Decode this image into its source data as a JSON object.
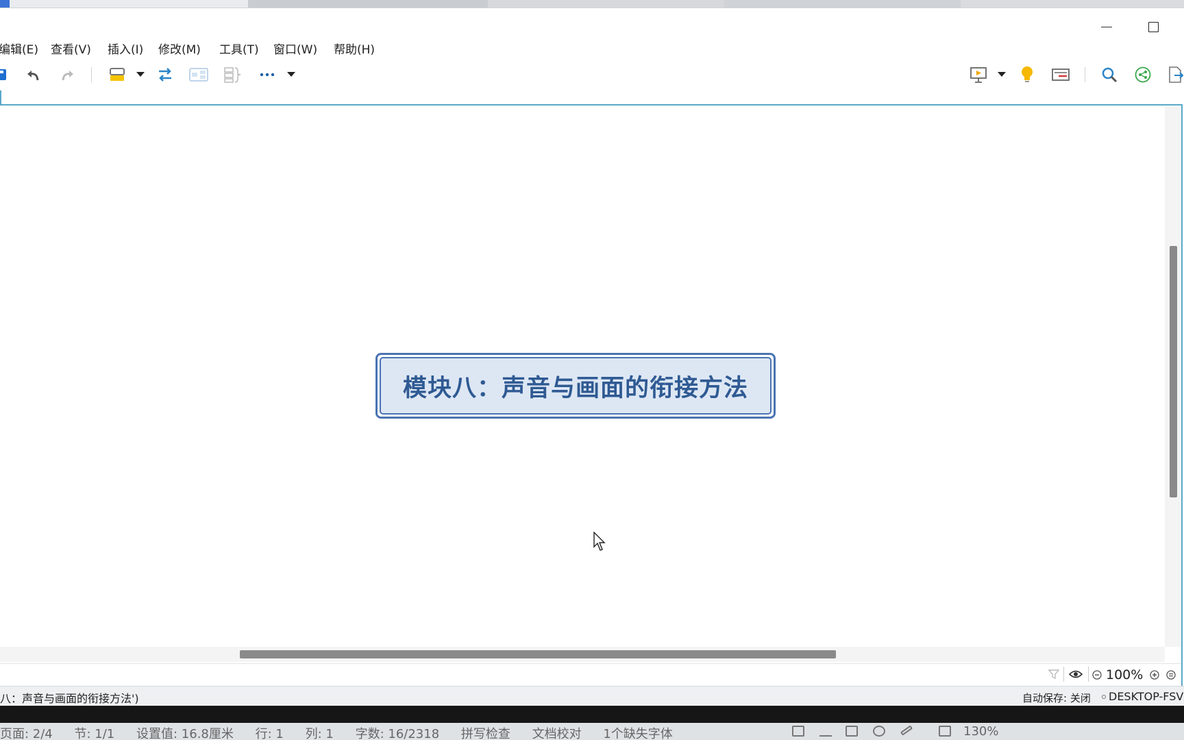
{
  "menu": {
    "items": [
      {
        "label": "编辑(E)"
      },
      {
        "label": "查看(V)"
      },
      {
        "label": "插入(I)"
      },
      {
        "label": "修改(M)"
      },
      {
        "label": "工具(T)"
      },
      {
        "label": "窗口(W)"
      },
      {
        "label": "帮助(H)"
      }
    ]
  },
  "toolbar": {
    "icons": [
      "save-icon",
      "undo-icon",
      "redo-icon",
      "insert-topic-icon",
      "dropdown-icon",
      "relationship-icon",
      "boundary-icon",
      "summary-icon",
      "more-icon",
      "dropdown-icon",
      "presentation-icon",
      "dropdown-icon",
      "idea-icon",
      "properties-icon",
      "search-icon",
      "share-icon",
      "export-icon"
    ]
  },
  "map": {
    "central_topic": "模块八：声音与画面的衔接方法"
  },
  "view": {
    "zoom": "100%"
  },
  "status": {
    "selection": "八：声音与画面的衔接方法')",
    "autosave": "自动保存: 关闭",
    "computer": "DESKTOP-FSV"
  },
  "word_status": {
    "page": "页面: 2/4",
    "section": "节: 1/1",
    "setting": "设置值: 16.8厘米",
    "row": "行: 1",
    "col": "列: 1",
    "words": "字数: 16/2318",
    "spell": "拼写检查",
    "proof": "文档校对",
    "missing_font": "1个缺失字体",
    "zoom": "130%"
  },
  "colors": {
    "accent": "#5aa8c8",
    "topic_border": "#4a73b2",
    "topic_fill": "#dde7f4",
    "topic_text": "#2f5a93"
  }
}
